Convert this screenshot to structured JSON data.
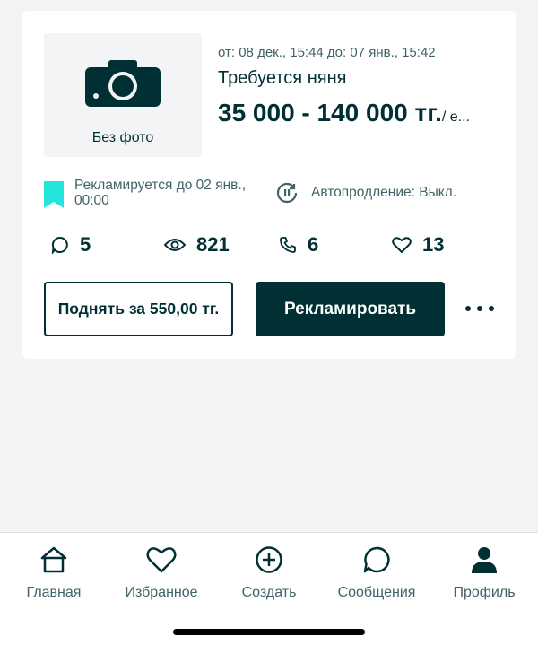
{
  "listing": {
    "photo_placeholder": "Без фото",
    "dates": "от: 08 дек., 15:44 до: 07 янв., 15:42",
    "title": "Требуется няня",
    "price": "35 000 - 140 000 тг.",
    "price_unit": "/ е...",
    "promo_text": "Рекламируется до 02 янв., 00:00",
    "autorenew_text": "Автопродление: Выкл.",
    "stats": {
      "messages": "5",
      "views": "821",
      "calls": "6",
      "favorites": "13"
    },
    "raise_button": "Поднять за 550,00 тг.",
    "promote_button": "Рекламировать"
  },
  "colors": {
    "primary": "#002f34",
    "promo_bookmark": "#23e5db",
    "muted": "#406367",
    "background": "#f2f4f5"
  },
  "tabbar": {
    "items": [
      {
        "label": "Главная",
        "icon": "home-icon"
      },
      {
        "label": "Избранное",
        "icon": "heart-icon"
      },
      {
        "label": "Создать",
        "icon": "plus-circle-icon"
      },
      {
        "label": "Сообщения",
        "icon": "chat-icon"
      },
      {
        "label": "Профиль",
        "icon": "profile-icon"
      }
    ]
  }
}
